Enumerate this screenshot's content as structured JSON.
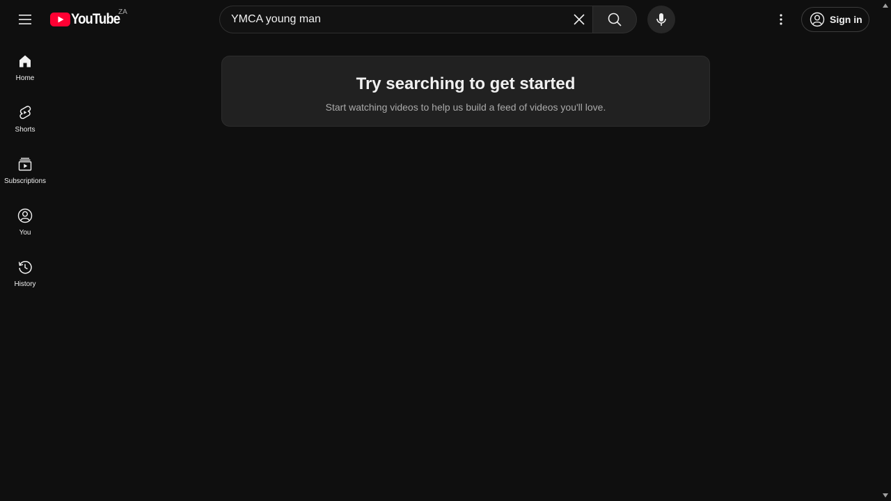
{
  "header": {
    "brand": "YouTube",
    "country_code": "ZA",
    "search": {
      "value": "YMCA young man",
      "placeholder": "Search"
    },
    "signin_label": "Sign in",
    "brand_color": "#ff0033"
  },
  "sidebar": {
    "items": [
      {
        "label": "Home",
        "icon": "home-icon"
      },
      {
        "label": "Shorts",
        "icon": "shorts-icon"
      },
      {
        "label": "Subscriptions",
        "icon": "subscriptions-icon"
      },
      {
        "label": "You",
        "icon": "account-icon"
      },
      {
        "label": "History",
        "icon": "history-icon"
      }
    ]
  },
  "main": {
    "prompt_title": "Try searching to get started",
    "prompt_subtitle": "Start watching videos to help us build a feed of videos you'll love."
  }
}
